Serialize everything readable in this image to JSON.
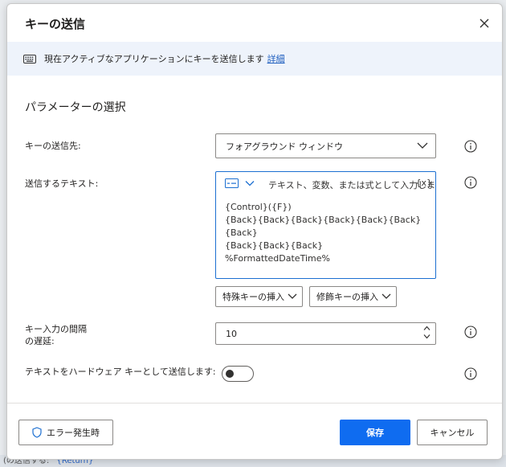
{
  "dialog": {
    "title": "キーの送信",
    "info_text": "現在アクティブなアプリケーションにキーを送信します",
    "info_link": "詳細",
    "section_title": "パラメーターの選択"
  },
  "fields": {
    "target": {
      "label": "キーの送信先:",
      "value": "フォアグラウンド ウィンドウ"
    },
    "text": {
      "label": "送信するテキスト:",
      "placeholder": "テキスト、変数、または式として入力しま",
      "variable_button": "{x}",
      "lines": [
        "{Control}({F})",
        "{Back}{Back}{Back}{Back}{Back}{Back}{Back}",
        "{Back}{Back}{Back}",
        "%FormattedDateTime%"
      ]
    },
    "insert_special_key": "特殊キーの挿入",
    "insert_modifier_key": "修飾キーの挿入",
    "delay": {
      "label_line1": "キー入力の間隔",
      "label_line2": "の遅延:",
      "value": "10"
    },
    "hardware": {
      "label": "テキストをハードウェア キーとして送信します:",
      "enabled": false
    }
  },
  "footer": {
    "on_error": "エラー発生時",
    "save": "保存",
    "cancel": "キャンセル"
  },
  "background": {
    "bottom_text": "(の送信する:",
    "bottom_link": "{Return}"
  },
  "colors": {
    "accent": "#0f6cf0",
    "info_bar": "#eef3fb",
    "link": "#1f5fbf"
  }
}
